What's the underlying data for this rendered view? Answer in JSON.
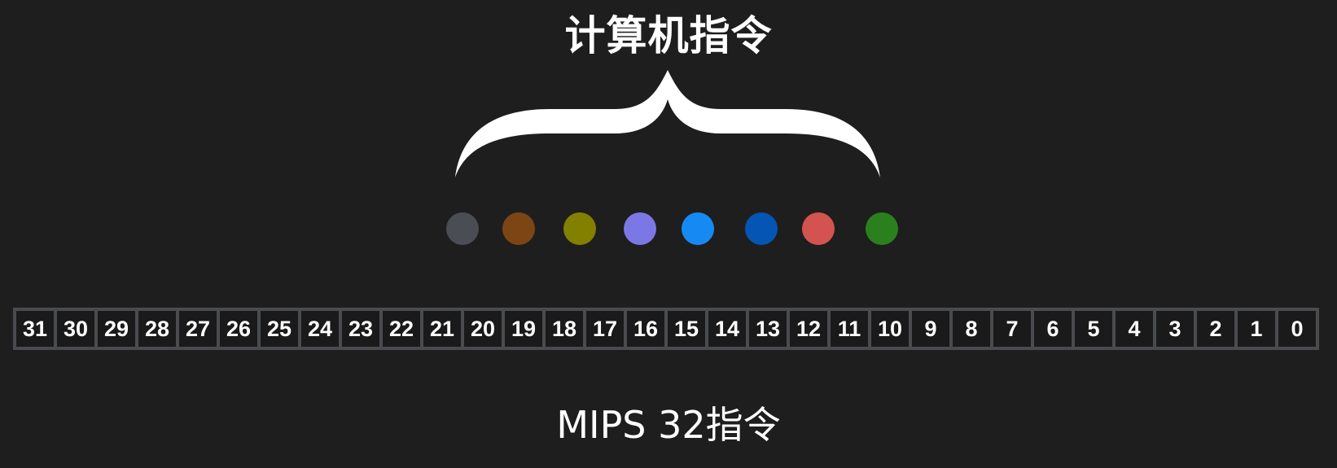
{
  "title": "计算机指令",
  "caption": "MIPS 32指令",
  "dots": [
    {
      "color": "#4b4d55"
    },
    {
      "color": "#7c4614"
    },
    {
      "color": "#838000"
    },
    {
      "color": "#7b78e6"
    },
    {
      "color": "#168af3"
    },
    {
      "color": "#0455b4"
    },
    {
      "color": "#d35350"
    },
    {
      "color": "#2a801d"
    }
  ],
  "bits": [
    "31",
    "30",
    "29",
    "28",
    "27",
    "26",
    "25",
    "24",
    "23",
    "22",
    "21",
    "20",
    "19",
    "18",
    "17",
    "16",
    "15",
    "14",
    "13",
    "12",
    "11",
    "10",
    "9",
    "8",
    "7",
    "6",
    "5",
    "4",
    "3",
    "2",
    "1",
    "0"
  ]
}
